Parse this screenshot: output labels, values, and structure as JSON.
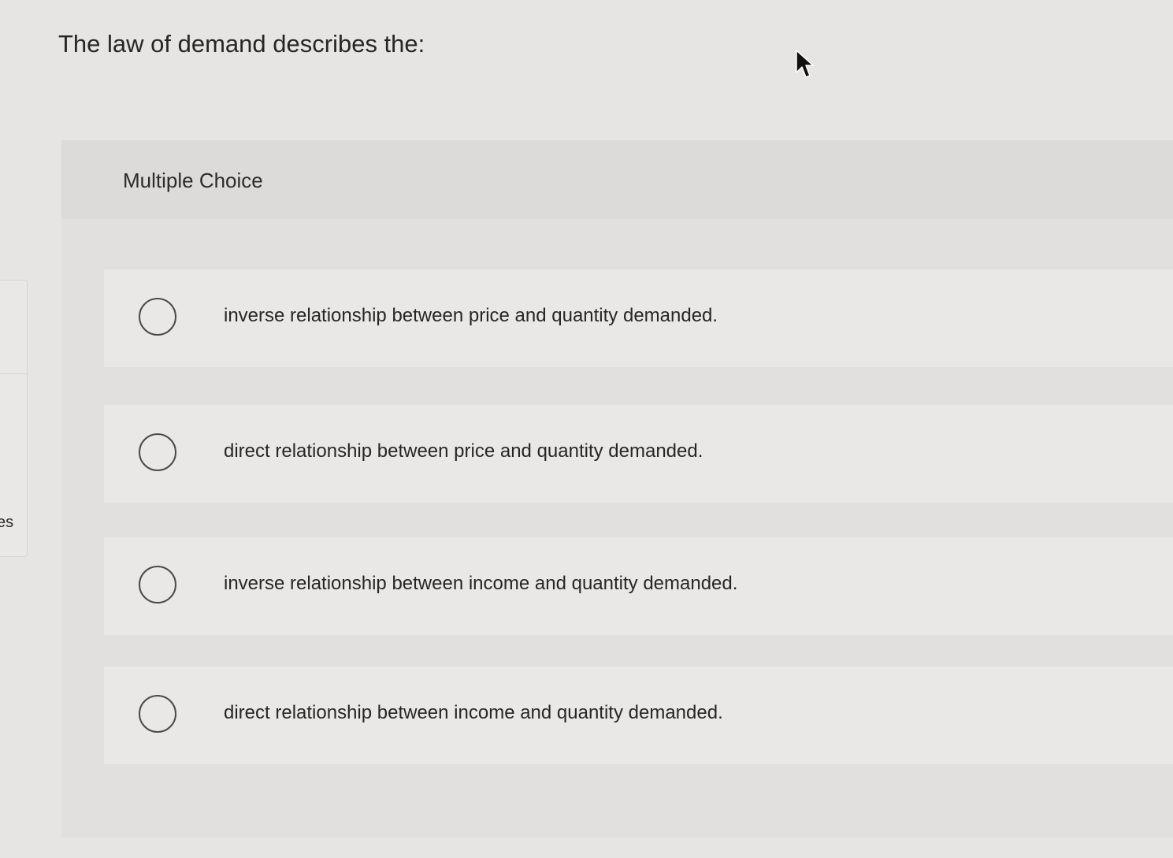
{
  "question": {
    "prompt": "The law of demand describes the:"
  },
  "side_panel": {
    "partial_text": "es"
  },
  "multiple_choice": {
    "header_label": "Multiple Choice",
    "choices": [
      {
        "label": "inverse relationship between price and quantity demanded.",
        "selected": false
      },
      {
        "label": "direct relationship between price and quantity demanded.",
        "selected": false
      },
      {
        "label": "inverse relationship between income and quantity demanded.",
        "selected": false
      },
      {
        "label": "direct relationship between income and quantity demanded.",
        "selected": false
      }
    ]
  },
  "icons": {
    "cursor": "mouse-pointer-icon",
    "radio": "radio-button-icon"
  },
  "colors": {
    "background": "#e6e5e3",
    "choice_background": "#e9e8e6",
    "text": "#262626",
    "radio_border": "#4a4a4a"
  }
}
